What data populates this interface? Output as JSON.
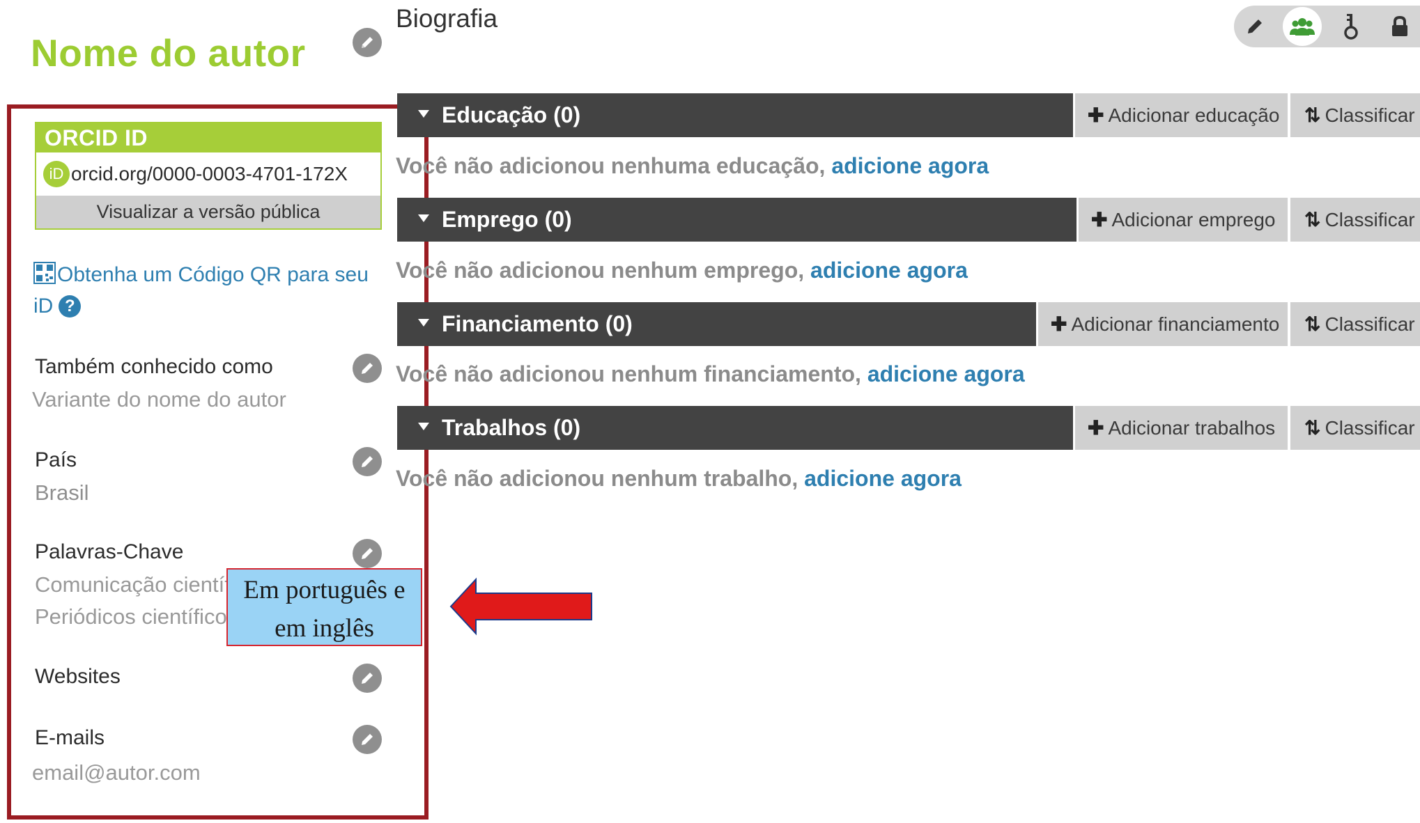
{
  "author": {
    "name": "Nome do autor"
  },
  "orcid": {
    "header": "ORCID ID",
    "logo_text": "iD",
    "id_url": "orcid.org/0000-0003-4701-172X",
    "public_link": "Visualizar a versão pública"
  },
  "qr": {
    "link_text": "Obtenha um Código QR para seu iD",
    "help_symbol": "?"
  },
  "fields": {
    "aka": {
      "label": "Também conhecido como",
      "value": "Variante do nome do autor"
    },
    "country": {
      "label": "País",
      "value": "Brasil"
    },
    "keywords": {
      "label": "Palavras-Chave",
      "values": [
        "Comunicação científica",
        "Periódicos científicos"
      ]
    },
    "websites": {
      "label": "Websites"
    },
    "emails": {
      "label": "E-mails",
      "value": "email@autor.com"
    }
  },
  "callout": {
    "line1": "Em português e",
    "line2": "em inglês"
  },
  "biography": {
    "title": "Biografia"
  },
  "visibility": {
    "icons": [
      "pencil-icon",
      "group-icon",
      "trusted-key-icon",
      "lock-icon"
    ],
    "active": "group-icon",
    "active_color": "#3f9c35"
  },
  "sections": {
    "education": {
      "title": "Educação (0)",
      "add_label": "Adicionar educação",
      "sort_label": "Classificar",
      "empty_text": "Você não adicionou nenhuma educação, ",
      "empty_link": "adicione agora"
    },
    "employment": {
      "title": "Emprego (0)",
      "add_label": "Adicionar emprego",
      "sort_label": "Classificar",
      "empty_text": "Você não adicionou nenhum emprego, ",
      "empty_link": "adicione agora"
    },
    "funding": {
      "title": "Financiamento (0)",
      "add_label": "Adicionar financiamento",
      "sort_label": "Classificar",
      "empty_text": "Você não adicionou nenhum financiamento, ",
      "empty_link": "adicione agora"
    },
    "works": {
      "title": "Trabalhos (0)",
      "add_label": "Adicionar trabalhos",
      "sort_label": "Classificar",
      "empty_text": "Você não adicionou nenhum trabalho, ",
      "empty_link": "adicione agora"
    }
  },
  "colors": {
    "orcid_green": "#a6ce39",
    "link_blue": "#2e7fb0",
    "bar_dark": "#434343",
    "highlight_red": "#9a1c22",
    "callout_blue": "#9ad3f5"
  }
}
